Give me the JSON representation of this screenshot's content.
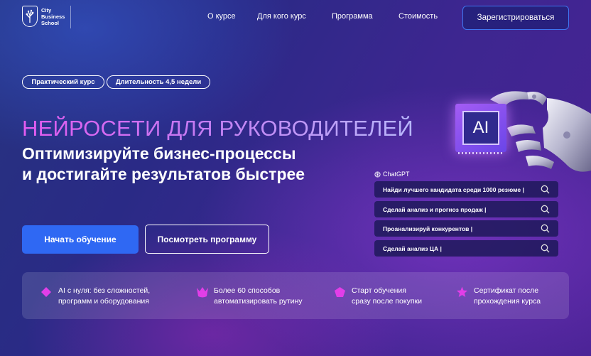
{
  "header": {
    "logo_text": "City Business School",
    "nav": [
      "О курсе",
      "Для кого курс",
      "Программа",
      "Стоимость"
    ],
    "register_label": "Зарегистрироваться"
  },
  "tags": [
    "Практический курс",
    "Длительность 4,5 недели"
  ],
  "hero": {
    "title": "НЕЙРОСЕТИ ДЛЯ РУКОВОДИТЕЛЕЙ",
    "subtitle_line1": "Оптимизируйте бизнес-процессы",
    "subtitle_line2": "и достигайте результатов быстрее",
    "start_label": "Начать обучение",
    "program_label": "Посмотреть программу"
  },
  "illustration": {
    "chip_text": "AI"
  },
  "chatgpt": {
    "label": "ChatGPT",
    "prompts": [
      "Найди лучшего кандидата среди 1000 резюме |",
      "Сделай анализ и прогноз продаж |",
      "Проанализируй конкурентов |",
      "Сделай  анализ ЦА |"
    ]
  },
  "features": [
    {
      "line1": "AI с нуля: без сложностей,",
      "line2": "программ и оборудования",
      "icon": "diamond-icon"
    },
    {
      "line1": "Более 60 способов",
      "line2": "автоматизировать рутину",
      "icon": "crown-icon"
    },
    {
      "line1": "Старт обучения",
      "line2": "сразу после покупки",
      "icon": "pentagon-icon"
    },
    {
      "line1": "Сертификат после",
      "line2": "прохождения курса",
      "icon": "star-icon"
    }
  ],
  "colors": {
    "accent": "#2f68f3",
    "magenta": "#e23ee8",
    "title_gradient_start": "#e35bf0"
  }
}
